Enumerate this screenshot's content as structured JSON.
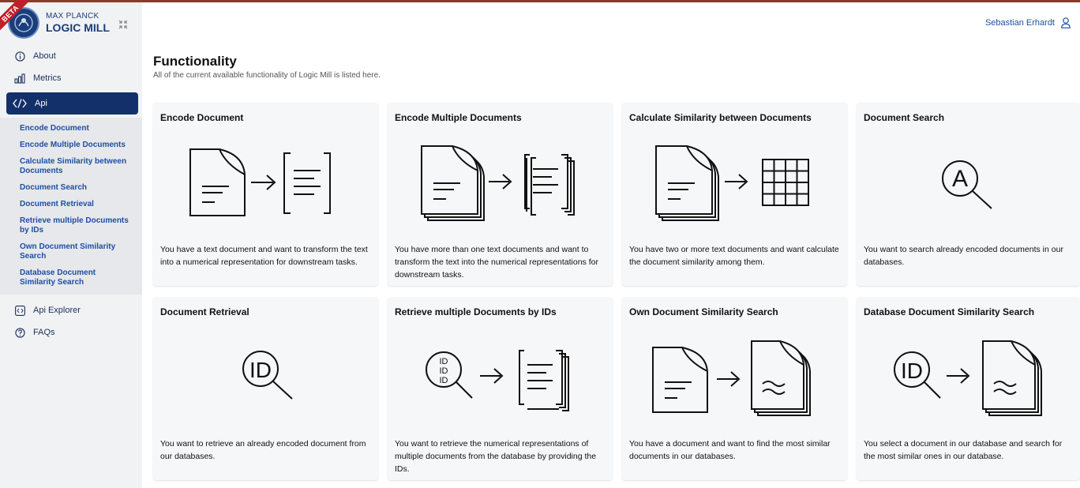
{
  "brand": {
    "beta": "BETA",
    "line1": "MAX PLANCK",
    "line2": "LOGIC MILL"
  },
  "user": {
    "name": "Sebastian Erhardt"
  },
  "sidebar": {
    "items": [
      {
        "label": "About",
        "icon": "info-icon"
      },
      {
        "label": "Metrics",
        "icon": "bar-chart-icon"
      },
      {
        "label": "Api",
        "icon": "code-icon"
      },
      {
        "label": "Api Explorer",
        "icon": "code-box-icon"
      },
      {
        "label": "FAQs",
        "icon": "question-icon"
      }
    ],
    "api_sub": [
      "Encode Document",
      "Encode Multiple Documents",
      "Calculate Similarity between Documents",
      "Document Search",
      "Document Retrieval",
      "Retrieve multiple Documents by IDs",
      "Own Document Similarity Search",
      "Database Document Similarity Search"
    ]
  },
  "main": {
    "title": "Functionality",
    "subtitle": "All of the current available functionality of Logic Mill is listed here.",
    "cards": [
      {
        "title": "Encode Document",
        "desc": "You have a text document and want to transform the text into a numerical representation for downstream tasks."
      },
      {
        "title": "Encode Multiple Documents",
        "desc": "You have more than one text documents and want to transform the text into the numerical representations for downstream tasks."
      },
      {
        "title": "Calculate Similarity between Documents",
        "desc": "You have two or more text documents and want calculate the document similarity among them."
      },
      {
        "title": "Document Search",
        "desc": "You want to search already encoded documents in our databases."
      },
      {
        "title": "Document Retrieval",
        "desc": "You want to retrieve an already encoded document from our databases."
      },
      {
        "title": "Retrieve multiple Documents by IDs",
        "desc": "You want to retrieve the numerical representations of multiple documents from the database by providing the IDs."
      },
      {
        "title": "Own Document Similarity Search",
        "desc": "You have a document and want to find the most similar documents in our databases."
      },
      {
        "title": "Database Document Similarity Search",
        "desc": "You select a document in our database and search for the most similar ones in our database."
      }
    ],
    "glyphs": {
      "letter_a": "A",
      "id": "ID",
      "approx": "≈"
    }
  }
}
